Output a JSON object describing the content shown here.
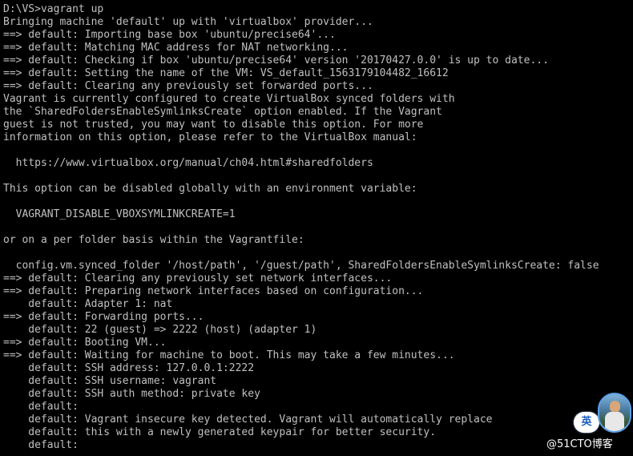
{
  "console": {
    "lines": [
      "D:\\VS>vagrant up",
      "Bringing machine 'default' up with 'virtualbox' provider...",
      "==> default: Importing base box 'ubuntu/precise64'...",
      "==> default: Matching MAC address for NAT networking...",
      "==> default: Checking if box 'ubuntu/precise64' version '20170427.0.0' is up to date...",
      "==> default: Setting the name of the VM: VS_default_1563179104482_16612",
      "==> default: Clearing any previously set forwarded ports...",
      "Vagrant is currently configured to create VirtualBox synced folders with",
      "the `SharedFoldersEnableSymlinksCreate` option enabled. If the Vagrant",
      "guest is not trusted, you may want to disable this option. For more",
      "information on this option, please refer to the VirtualBox manual:",
      "",
      "  https://www.virtualbox.org/manual/ch04.html#sharedfolders",
      "",
      "This option can be disabled globally with an environment variable:",
      "",
      "  VAGRANT_DISABLE_VBOXSYMLINKCREATE=1",
      "",
      "or on a per folder basis within the Vagrantfile:",
      "",
      "  config.vm.synced_folder '/host/path', '/guest/path', SharedFoldersEnableSymlinksCreate: false",
      "==> default: Clearing any previously set network interfaces...",
      "==> default: Preparing network interfaces based on configuration...",
      "    default: Adapter 1: nat",
      "==> default: Forwarding ports...",
      "    default: 22 (guest) => 2222 (host) (adapter 1)",
      "==> default: Booting VM...",
      "==> default: Waiting for machine to boot. This may take a few minutes...",
      "    default: SSH address: 127.0.0.1:2222",
      "    default: SSH username: vagrant",
      "    default: SSH auth method: private key",
      "    default:",
      "    default: Vagrant insecure key detected. Vagrant will automatically replace",
      "    default: this with a newly generated keypair for better security.",
      "    default:"
    ]
  },
  "overlay": {
    "ime_label": "英",
    "watermark": "@51CTO博客",
    "avatar_icon": "user-avatar",
    "colors": {
      "background": "#000000",
      "text": "#c0c0c0",
      "ime_text": "#1e5fbf"
    }
  }
}
